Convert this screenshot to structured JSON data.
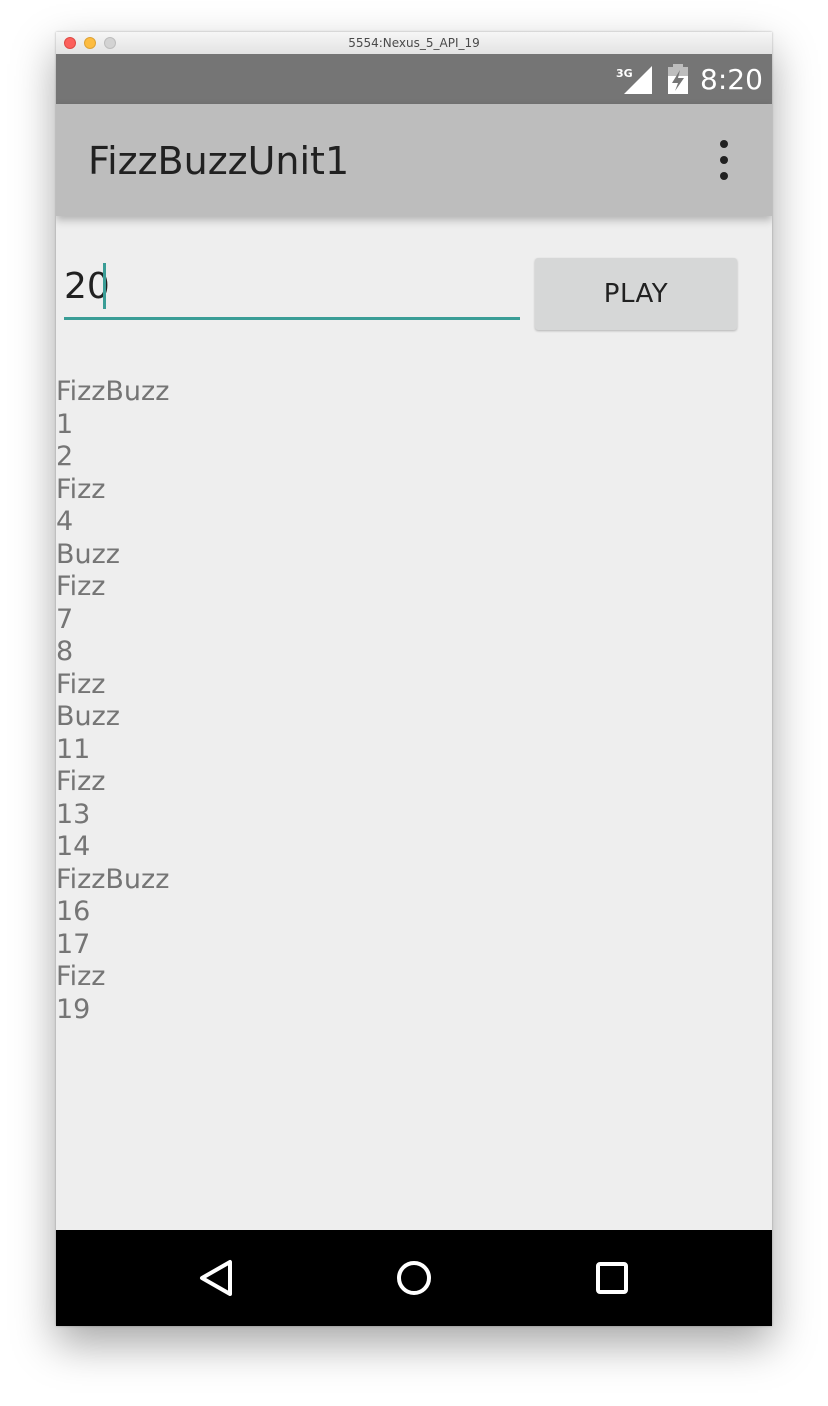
{
  "window": {
    "title": "5554:Nexus_5_API_19"
  },
  "statusbar": {
    "network": "3G",
    "time": "8:20",
    "signal_icon": "signal-icon",
    "battery_icon": "battery-charging-icon"
  },
  "appbar": {
    "title": "FizzBuzzUnit1",
    "overflow_icon": "more-vert-icon"
  },
  "form": {
    "input_value": "20",
    "play_label": "PLAY"
  },
  "output": {
    "lines": [
      "FizzBuzz",
      "1",
      "2",
      "Fizz",
      "4",
      "Buzz",
      "Fizz",
      "7",
      "8",
      "Fizz",
      "Buzz",
      "11",
      "Fizz",
      "13",
      "14",
      "FizzBuzz",
      "16",
      "17",
      "Fizz",
      "19"
    ]
  },
  "navbar": {
    "back_icon": "back-icon",
    "home_icon": "home-icon",
    "recents_icon": "recents-icon"
  },
  "colors": {
    "statusbar": "#757575",
    "appbar": "#bdbdbd",
    "accent": "#3a9d96",
    "background": "#eeeeee",
    "button": "#d6d7d7"
  }
}
